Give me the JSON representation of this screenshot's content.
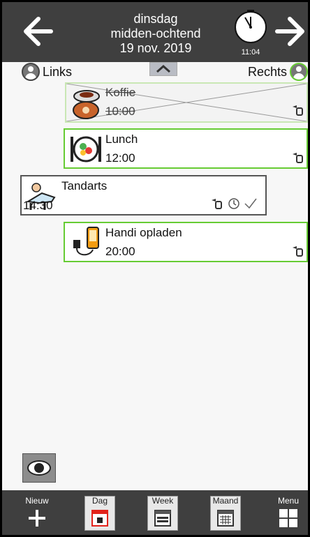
{
  "header": {
    "weekday": "dinsdag",
    "daypart": "midden-ochtend",
    "date": "19 nov. 2019",
    "clock_time": "11:04"
  },
  "sides": {
    "left_label": "Links",
    "right_label": "Rechts"
  },
  "items": [
    {
      "title": "Koffie",
      "time": "10:00",
      "state": "done"
    },
    {
      "title": "Lunch",
      "time": "12:00",
      "state": "active"
    },
    {
      "title": "Tandarts",
      "time": "14:30",
      "state": "left"
    },
    {
      "title": "Handi opladen",
      "time": "20:00",
      "state": "active"
    }
  ],
  "bottombar": {
    "new_label": "Nieuw",
    "day_label": "Dag",
    "week_label": "Week",
    "month_label": "Maand",
    "menu_label": "Menu"
  },
  "colors": {
    "header_bg": "#3f3f3f",
    "accent_green": "#66cc33"
  }
}
